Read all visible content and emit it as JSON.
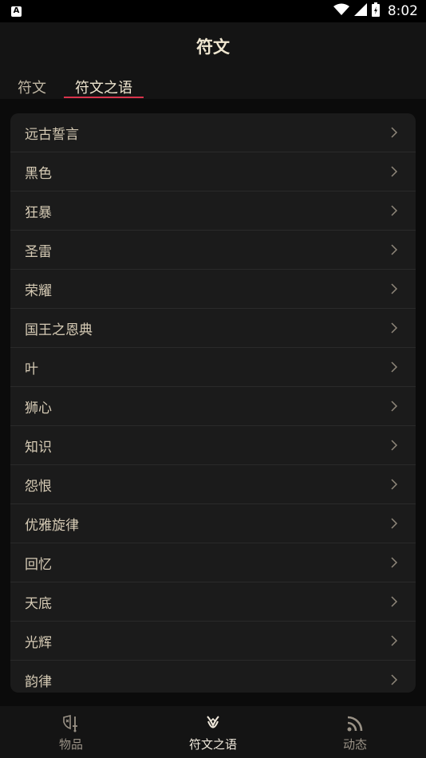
{
  "status_bar": {
    "time": "8:02",
    "notif_icon_text": "A",
    "battery_text": ""
  },
  "header": {
    "title": "符文"
  },
  "tabs": [
    {
      "label": "符文",
      "active": false
    },
    {
      "label": "符文之语",
      "active": true
    }
  ],
  "list": {
    "items": [
      {
        "label": "远古誓言"
      },
      {
        "label": "黑色"
      },
      {
        "label": "狂暴"
      },
      {
        "label": "圣雷"
      },
      {
        "label": "荣耀"
      },
      {
        "label": "国王之恩典"
      },
      {
        "label": "叶"
      },
      {
        "label": "狮心"
      },
      {
        "label": "知识"
      },
      {
        "label": "怨恨"
      },
      {
        "label": "优雅旋律"
      },
      {
        "label": "回忆"
      },
      {
        "label": "天底"
      },
      {
        "label": "光辉"
      },
      {
        "label": "韵律"
      }
    ]
  },
  "bottom_nav": {
    "items": [
      {
        "label": "物品",
        "icon": "shield-sword-icon",
        "active": false
      },
      {
        "label": "符文之语",
        "icon": "rune-icon",
        "active": true
      },
      {
        "label": "动态",
        "icon": "rss-icon",
        "active": false
      }
    ]
  },
  "colors": {
    "accent": "#d9334b",
    "background": "#0b0b0b",
    "card": "#1b1b1b",
    "text": "#d6cbb5"
  }
}
